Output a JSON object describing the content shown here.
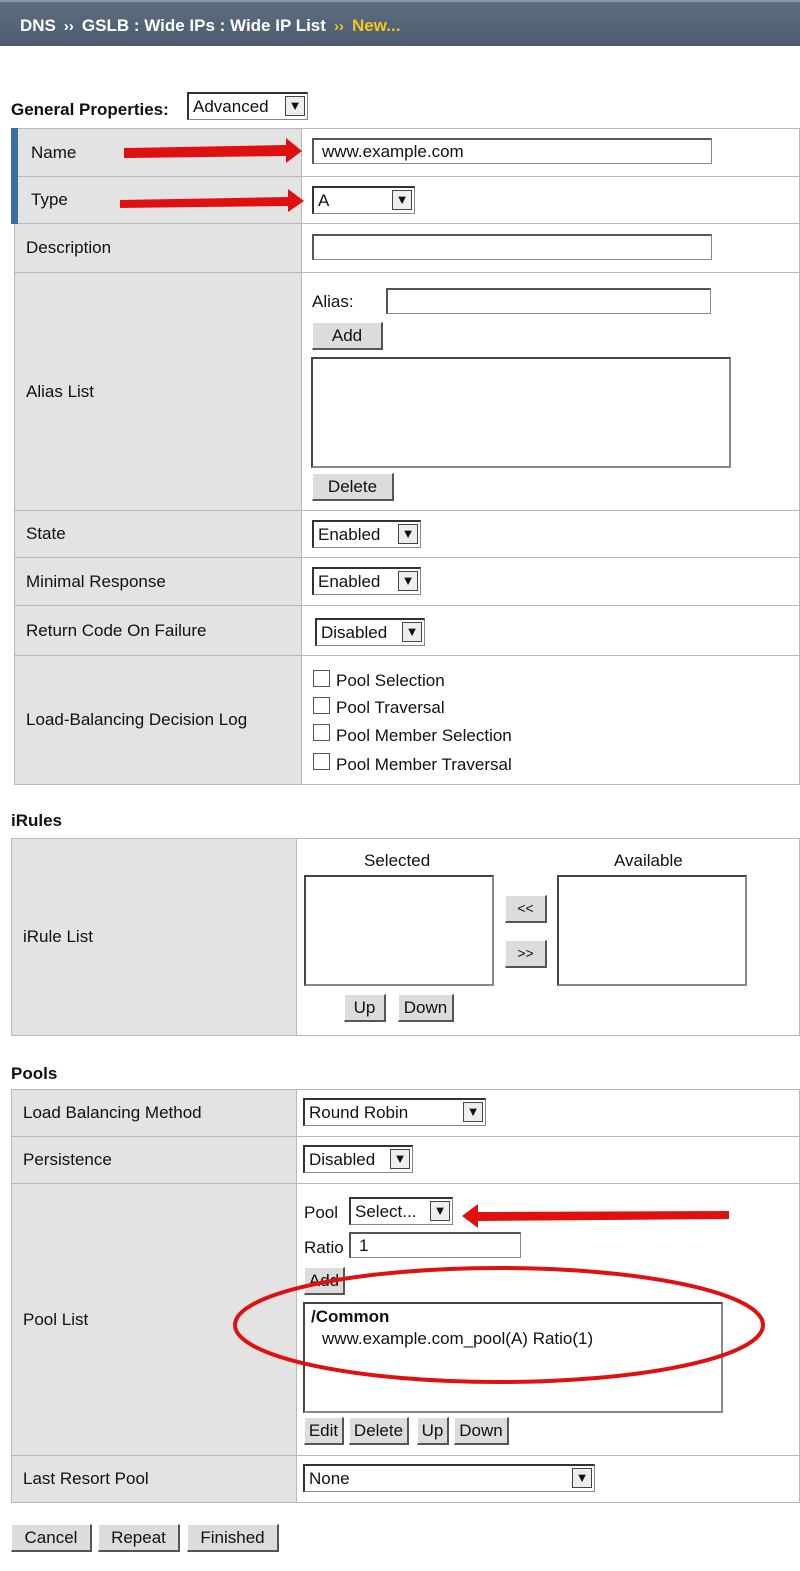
{
  "breadcrumb": {
    "dns": "DNS",
    "gslb": "GSLB : Wide IPs : Wide IP List",
    "current": "New...",
    "sep": "››"
  },
  "general": {
    "heading": "General Properties:",
    "mode": "Advanced",
    "name": {
      "label": "Name",
      "value": "www.example.com"
    },
    "type": {
      "label": "Type",
      "value": "A"
    },
    "description": {
      "label": "Description",
      "value": ""
    },
    "alias": {
      "label": "Alias List",
      "alias_label": "Alias:",
      "add": "Add",
      "delete": "Delete"
    },
    "state": {
      "label": "State",
      "value": "Enabled"
    },
    "minimal": {
      "label": "Minimal Response",
      "value": "Enabled"
    },
    "return_code": {
      "label": "Return Code On Failure",
      "value": "Disabled"
    },
    "lb_log": {
      "label": "Load-Balancing Decision Log",
      "options": [
        "Pool Selection",
        "Pool Traversal",
        "Pool Member Selection",
        "Pool Member Traversal"
      ],
      "checked": [
        false,
        false,
        false,
        false
      ]
    }
  },
  "irules": {
    "heading": "iRules",
    "label": "iRule List",
    "selected": "Selected",
    "available": "Available",
    "move_left": "<<",
    "move_right": ">>",
    "up": "Up",
    "down": "Down"
  },
  "pools": {
    "heading": "Pools",
    "method": {
      "label": "Load Balancing Method",
      "value": "Round Robin"
    },
    "persistence": {
      "label": "Persistence",
      "value": "Disabled"
    },
    "pool_list": {
      "label": "Pool List",
      "pool_label": "Pool",
      "pool_value": "Select...",
      "ratio_label": "Ratio",
      "ratio_value": "1",
      "add": "Add",
      "group": "/Common",
      "entry": "www.example.com_pool(A) Ratio(1)",
      "edit": "Edit",
      "delete": "Delete",
      "up": "Up",
      "down": "Down"
    },
    "last_resort": {
      "label": "Last Resort Pool",
      "value": "None"
    }
  },
  "actions": {
    "cancel": "Cancel",
    "repeat": "Repeat",
    "finished": "Finished"
  },
  "colors": {
    "annotation": "#e01010",
    "header": "#55657a",
    "required_marker": "#3a6ea5"
  }
}
